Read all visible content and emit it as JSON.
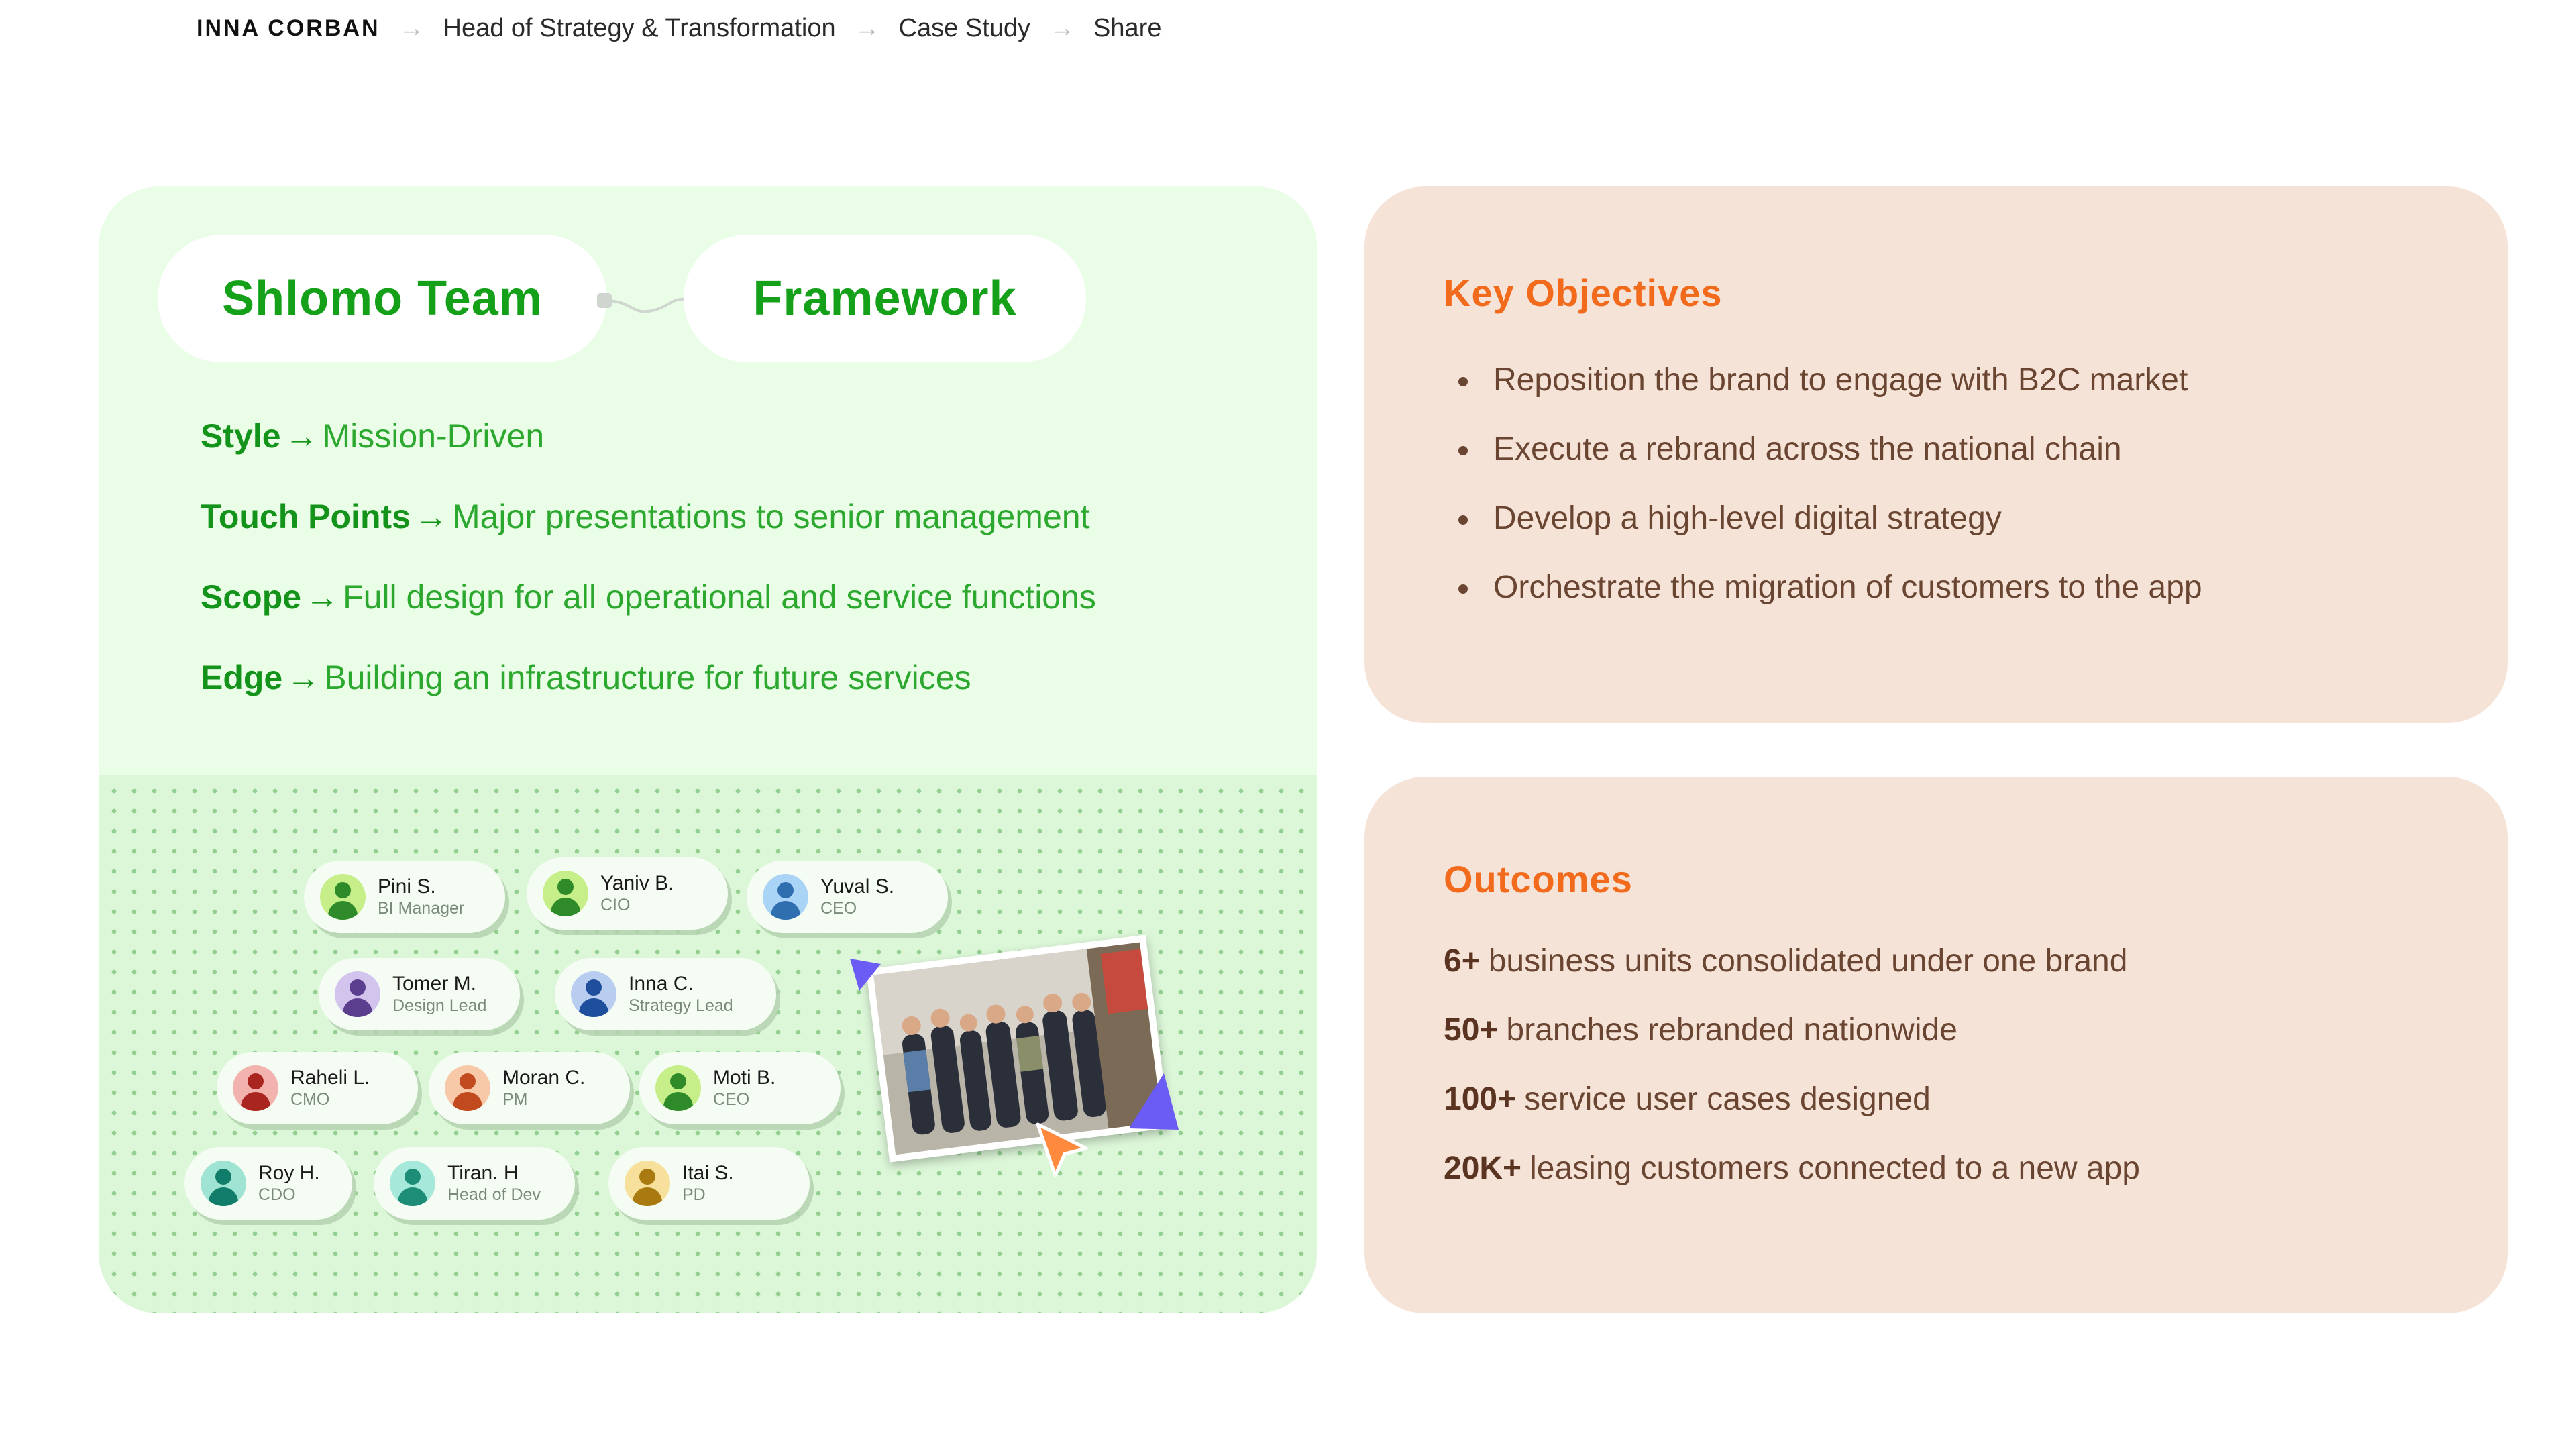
{
  "breadcrumb": {
    "brand": "INNA CORBAN",
    "items": [
      "Head of Strategy & Transformation",
      "Case Study",
      "Share"
    ],
    "separator": "→"
  },
  "left_card": {
    "pill_team": "Shlomo Team",
    "pill_framework": "Framework",
    "arrow": "→",
    "framework": [
      {
        "key": "Style",
        "value": "Mission-Driven"
      },
      {
        "key": "Touch Points",
        "value": "Major presentations to senior management"
      },
      {
        "key": "Scope",
        "value": "Full design for all operational and service functions"
      },
      {
        "key": "Edge",
        "value": "Building an infrastructure for future services"
      }
    ],
    "team": [
      {
        "name": "Pini S.",
        "role": "BI Manager"
      },
      {
        "name": "Yaniv B.",
        "role": "CIO"
      },
      {
        "name": "Yuval S.",
        "role": "CEO"
      },
      {
        "name": "Tomer M.",
        "role": "Design Lead"
      },
      {
        "name": "Inna C.",
        "role": "Strategy Lead"
      },
      {
        "name": "Raheli L.",
        "role": "CMO"
      },
      {
        "name": "Moran C.",
        "role": "PM"
      },
      {
        "name": "Moti B.",
        "role": "CEO"
      },
      {
        "name": "Roy H.",
        "role": "CDO"
      },
      {
        "name": "Tiran. H",
        "role": "Head of Dev"
      },
      {
        "name": "Itai S.",
        "role": "PD"
      }
    ]
  },
  "objectives": {
    "title": "Key Objectives",
    "items": [
      "Reposition the brand to engage with B2C market",
      "Execute a rebrand across the national chain",
      "Develop a high-level digital strategy",
      "Orchestrate the migration of customers to the app"
    ]
  },
  "outcomes": {
    "title": "Outcomes",
    "items": [
      {
        "number": "6+",
        "text": "business units consolidated under one brand"
      },
      {
        "number": "50+",
        "text": "branches rebranded nationwide"
      },
      {
        "number": "100+",
        "text": "service user cases designed"
      },
      {
        "number": "20K+",
        "text": "leasing customers connected to a new app"
      }
    ]
  },
  "colors": {
    "green_accent": "#14a018",
    "orange_accent": "#f26b1d",
    "brown_text": "#6a4632",
    "left_card_bg": "#e9fde7",
    "right_card_bg": "#f6e3d7"
  }
}
